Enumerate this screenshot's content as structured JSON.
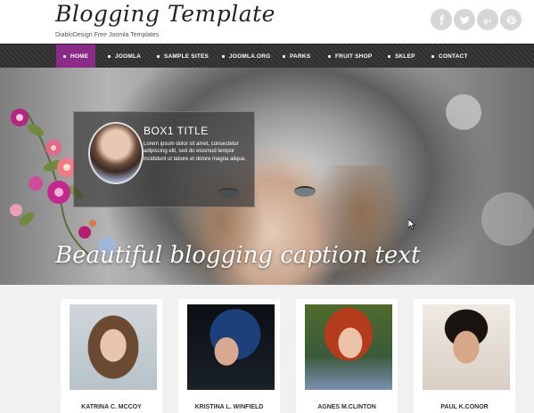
{
  "site": {
    "logo": "Blogging Template",
    "tagline": "DiabloDesign Free Joomla Templates"
  },
  "social": [
    "facebook-icon",
    "twitter-icon",
    "google-plus-icon",
    "pinterest-icon"
  ],
  "nav": {
    "items": [
      {
        "label": "HOME",
        "active": true
      },
      {
        "label": "JOOMLA"
      },
      {
        "label": "SAMPLE SITES"
      },
      {
        "label": "JOOMLA.ORG"
      },
      {
        "label": "PARKS"
      },
      {
        "label": "FRUIT SHOP"
      },
      {
        "label": "SKLEP"
      },
      {
        "label": "CONTACT"
      }
    ]
  },
  "hero": {
    "box_title": "BOX1 TITLE",
    "box_text": "Lorem ipsum dolor sit amet, consectetur adipiscing elit, sed do eiusmod tempor incididunt ut labore et dolore magna aliqua.",
    "caption": "Beautiful blogging caption text"
  },
  "team": [
    {
      "name": "KATRINA C. MCCOY"
    },
    {
      "name": "KRISTINA L. WINFIELD"
    },
    {
      "name": "AGNES M.CLINTON"
    },
    {
      "name": "PAUL K.CONOR"
    }
  ],
  "colors": {
    "accent": "#8c2a88",
    "nav_bg": "#333333",
    "social_bg": "#d6d6d6"
  }
}
